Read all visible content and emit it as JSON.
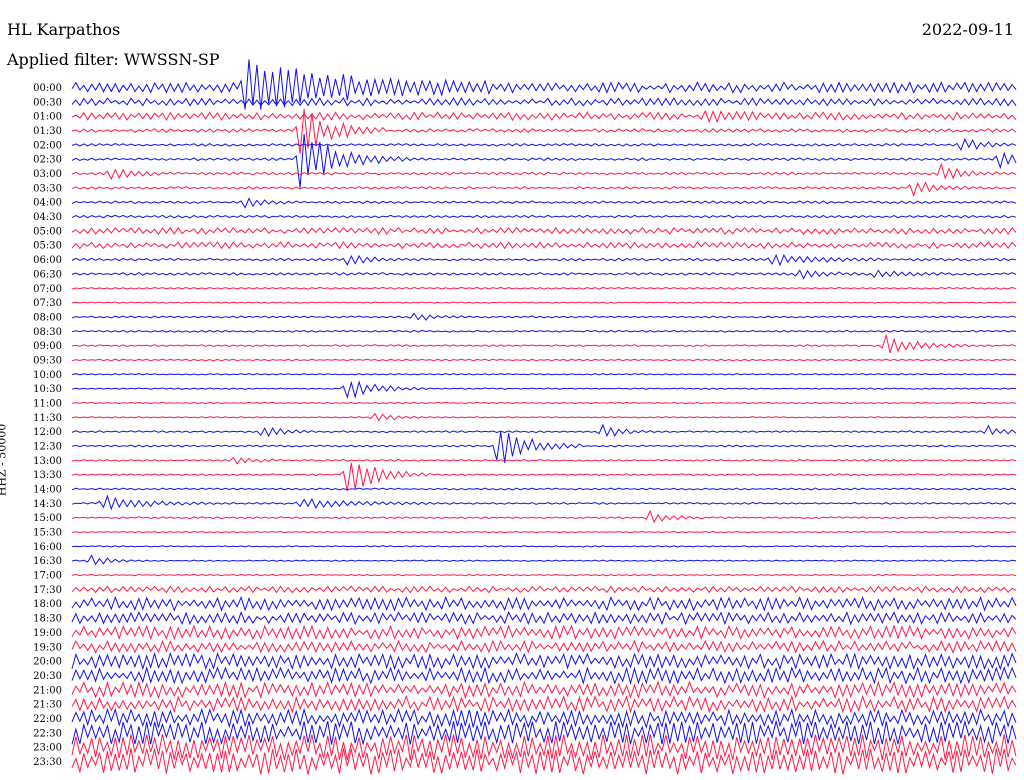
{
  "header": {
    "station": "HL Karpathos",
    "date": "2022-09-11",
    "filter": "Applied filter: WWSSN-SP"
  },
  "chart_data": {
    "type": "line",
    "ylabel": "HHZ - 50000",
    "line_interval_minutes": 15,
    "colors": [
      "#1010e8",
      "#ff1a4a"
    ],
    "row_labels": [
      "00:00",
      "00:30",
      "01:00",
      "01:30",
      "02:00",
      "02:30",
      "03:00",
      "03:30",
      "04:00",
      "04:30",
      "05:00",
      "05:30",
      "06:00",
      "06:30",
      "07:00",
      "07:30",
      "08:00",
      "08:30",
      "09:00",
      "09:30",
      "10:00",
      "10:30",
      "11:00",
      "11:30",
      "12:00",
      "12:30",
      "13:00",
      "13:30",
      "14:00",
      "14:30",
      "15:00",
      "15:30",
      "16:00",
      "16:30",
      "17:00",
      "17:30",
      "18:00",
      "18:30",
      "19:00",
      "19:30",
      "20:00",
      "20:30",
      "21:00",
      "21:30",
      "22:00",
      "22:30",
      "23:00",
      "23:30"
    ],
    "noise_level": [
      4,
      3,
      3,
      1.5,
      1,
      1,
      1,
      1,
      1,
      1,
      2.5,
      2.5,
      1,
      1,
      0.7,
      0.5,
      0.7,
      0.7,
      0.7,
      0.7,
      0.5,
      0.5,
      0.5,
      0.5,
      0.7,
      0.7,
      0.7,
      0.7,
      0.7,
      0.7,
      0.7,
      0.5,
      0.5,
      0.5,
      0.5,
      2.5,
      5,
      4.5,
      5,
      4.5,
      6,
      6,
      6,
      6,
      7,
      9,
      10,
      10
    ],
    "events": [
      {
        "row": 0,
        "t": 0.18,
        "amp": 30,
        "dur": 0.09
      },
      {
        "row": 2,
        "t": 0.67,
        "amp": 6,
        "dur": 0.02
      },
      {
        "row": 3,
        "t": 0.24,
        "amp": 28,
        "dur": 0.03
      },
      {
        "row": 4,
        "t": 0.94,
        "amp": 8,
        "dur": 0.02
      },
      {
        "row": 5,
        "t": 0.24,
        "amp": 30,
        "dur": 0.04
      },
      {
        "row": 5,
        "t": 0.98,
        "amp": 10,
        "dur": 0.02
      },
      {
        "row": 6,
        "t": 0.04,
        "amp": 8,
        "dur": 0.02
      },
      {
        "row": 6,
        "t": 0.92,
        "amp": 9,
        "dur": 0.02
      },
      {
        "row": 7,
        "t": 0.89,
        "amp": 9,
        "dur": 0.02
      },
      {
        "row": 8,
        "t": 0.18,
        "amp": 6,
        "dur": 0.02
      },
      {
        "row": 12,
        "t": 0.29,
        "amp": 7,
        "dur": 0.02
      },
      {
        "row": 12,
        "t": 0.74,
        "amp": 7,
        "dur": 0.04
      },
      {
        "row": 13,
        "t": 0.77,
        "amp": 6,
        "dur": 0.02
      },
      {
        "row": 13,
        "t": 0.85,
        "amp": 6,
        "dur": 0.02
      },
      {
        "row": 16,
        "t": 0.36,
        "amp": 5,
        "dur": 0.02
      },
      {
        "row": 18,
        "t": 0.86,
        "amp": 12,
        "dur": 0.03
      },
      {
        "row": 21,
        "t": 0.29,
        "amp": 12,
        "dur": 0.03
      },
      {
        "row": 23,
        "t": 0.32,
        "amp": 6,
        "dur": 0.02
      },
      {
        "row": 24,
        "t": 0.2,
        "amp": 7,
        "dur": 0.02
      },
      {
        "row": 24,
        "t": 0.56,
        "amp": 9,
        "dur": 0.02
      },
      {
        "row": 24,
        "t": 0.97,
        "amp": 6,
        "dur": 0.02
      },
      {
        "row": 25,
        "t": 0.45,
        "amp": 22,
        "dur": 0.03
      },
      {
        "row": 26,
        "t": 0.17,
        "amp": 5,
        "dur": 0.02
      },
      {
        "row": 27,
        "t": 0.29,
        "amp": 22,
        "dur": 0.03
      },
      {
        "row": 29,
        "t": 0.03,
        "amp": 8,
        "dur": 0.04
      },
      {
        "row": 29,
        "t": 0.24,
        "amp": 6,
        "dur": 0.05
      },
      {
        "row": 30,
        "t": 0.61,
        "amp": 7,
        "dur": 0.02
      },
      {
        "row": 33,
        "t": 0.02,
        "amp": 5,
        "dur": 0.02
      }
    ]
  }
}
